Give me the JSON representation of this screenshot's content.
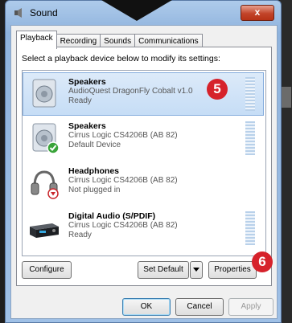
{
  "window": {
    "title": "Sound",
    "close_label": "x"
  },
  "tabs": [
    {
      "label": "Playback",
      "active": true
    },
    {
      "label": "Recording",
      "active": false
    },
    {
      "label": "Sounds",
      "active": false
    },
    {
      "label": "Communications",
      "active": false
    }
  ],
  "instruction": "Select a playback device below to modify its settings:",
  "devices": [
    {
      "name": "Speakers",
      "description": "AudioQuest DragonFly Cobalt v1.0",
      "status": "Ready",
      "icon": "speaker-icon",
      "selected": true,
      "meter": true
    },
    {
      "name": "Speakers",
      "description": "Cirrus Logic CS4206B (AB 82)",
      "status": "Default Device",
      "icon": "speaker-default-icon",
      "selected": false,
      "meter": true
    },
    {
      "name": "Headphones",
      "description": "Cirrus Logic CS4206B (AB 82)",
      "status": "Not plugged in",
      "icon": "headphones-icon",
      "selected": false,
      "meter": false
    },
    {
      "name": "Digital Audio (S/PDIF)",
      "description": "Cirrus Logic CS4206B (AB 82)",
      "status": "Ready",
      "icon": "digital-receiver-icon",
      "selected": false,
      "meter": true
    }
  ],
  "annotations": {
    "marker_5": "5",
    "marker_6": "6"
  },
  "buttons": {
    "configure": "Configure",
    "set_default": "Set Default",
    "properties": "Properties",
    "ok": "OK",
    "cancel": "Cancel",
    "apply": "Apply"
  },
  "colors": {
    "annotation_badge": "#d6222b",
    "selection": "#c6ddf6"
  }
}
